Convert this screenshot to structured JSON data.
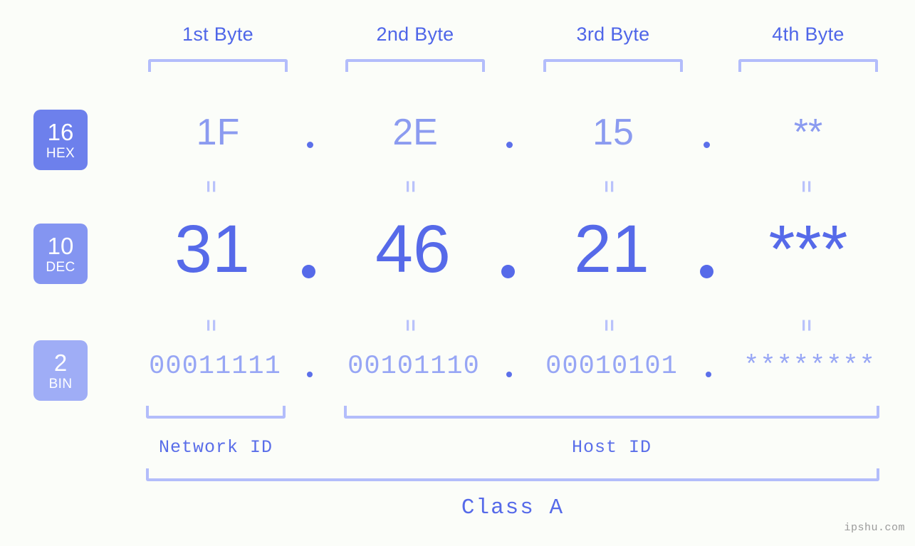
{
  "page": {
    "background": "#fbfdf9",
    "accent": "#566ae9",
    "accent_light": "#b3bdfb",
    "watermark": "ipshu.com"
  },
  "headers": [
    {
      "label": "1st Byte"
    },
    {
      "label": "2nd Byte"
    },
    {
      "label": "3rd Byte"
    },
    {
      "label": "4th Byte"
    }
  ],
  "rows": [
    {
      "base": "16",
      "base_name": "HEX",
      "badge_color": "#6d80ec",
      "values": [
        "1F",
        "2E",
        "15",
        "**"
      ]
    },
    {
      "base": "10",
      "base_name": "DEC",
      "badge_color": "#8495f1",
      "values": [
        "31",
        "46",
        "21",
        "***"
      ]
    },
    {
      "base": "2",
      "base_name": "BIN",
      "badge_color": "#9fadf6",
      "values": [
        "00011111",
        "00101110",
        "00010101",
        "********"
      ]
    }
  ],
  "separators": {
    "hex": [
      ".",
      ".",
      "."
    ],
    "dec": [
      ".",
      ".",
      "."
    ],
    "bin": [
      ".",
      ".",
      "."
    ]
  },
  "equals_marker": "=",
  "segments": [
    {
      "label": "Network ID"
    },
    {
      "label": "Host ID"
    }
  ],
  "class": {
    "label": "Class A"
  }
}
